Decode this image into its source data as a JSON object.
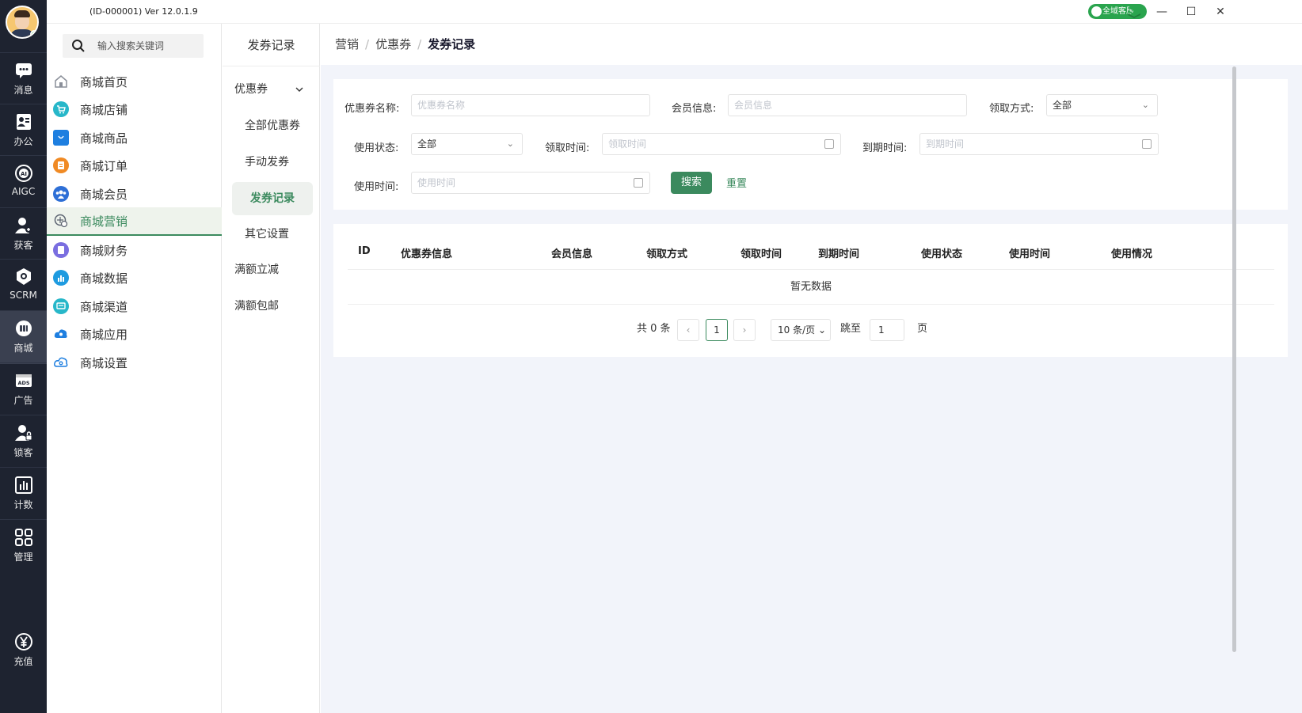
{
  "topbar": {
    "version": "(ID-000001)  Ver 12.0.1.9",
    "service_label": "全域客服",
    "minimize": "—",
    "maximize": "☐",
    "close": "✕"
  },
  "rail": [
    {
      "label": "消息",
      "icon": "chat-icon"
    },
    {
      "label": "办公",
      "icon": "id-card-icon"
    },
    {
      "label": "AIGC",
      "icon": "ai-icon"
    },
    {
      "label": "获客",
      "icon": "user-add-icon"
    },
    {
      "label": "SCRM",
      "icon": "scrm-icon"
    },
    {
      "label": "商城",
      "icon": "store-icon"
    },
    {
      "label": "广告",
      "icon": "ads-icon"
    },
    {
      "label": "锁客",
      "icon": "user-lock-icon"
    },
    {
      "label": "计数",
      "icon": "bar-chart-icon"
    },
    {
      "label": "管理",
      "icon": "grid-icon"
    },
    {
      "label": "充值",
      "icon": "yen-icon"
    }
  ],
  "search": {
    "placeholder": "输入搜索关键词"
  },
  "menu": [
    {
      "label": "商城首页",
      "color": "#8a8f99"
    },
    {
      "label": "商城店铺",
      "color": "#27b7c9"
    },
    {
      "label": "商城商品",
      "color": "#1e7fe0"
    },
    {
      "label": "商城订单",
      "color": "#f08a24"
    },
    {
      "label": "商城会员",
      "color": "#2e6fd6"
    },
    {
      "label": "商城营销",
      "color": "#3b8a5e"
    },
    {
      "label": "商城财务",
      "color": "#7a6ee0"
    },
    {
      "label": "商城数据",
      "color": "#1e9be0"
    },
    {
      "label": "商城渠道",
      "color": "#27b7c9"
    },
    {
      "label": "商城应用",
      "color": "#1e7fe0"
    },
    {
      "label": "商城设置",
      "color": "#1e7fe0"
    }
  ],
  "subnav": {
    "title": "发券记录",
    "group": "优惠券",
    "items": [
      "全部优惠券",
      "手动发券",
      "发券记录",
      "其它设置"
    ],
    "extra": [
      "满额立减",
      "满额包邮"
    ]
  },
  "breadcrumb": [
    "营销",
    "优惠券",
    "发券记录"
  ],
  "filters": {
    "coupon_name_label": "优惠券名称:",
    "coupon_name_placeholder": "优惠券名称",
    "member_label": "会员信息:",
    "member_placeholder": "会员信息",
    "receive_method_label": "领取方式:",
    "receive_method_value": "全部",
    "use_status_label": "使用状态:",
    "use_status_value": "全部",
    "receive_time_label": "领取时间:",
    "receive_time_placeholder": "领取时间",
    "expire_time_label": "到期时间:",
    "expire_time_placeholder": "到期时间",
    "use_time_label": "使用时间:",
    "use_time_placeholder": "使用时间",
    "search_button": "搜索",
    "reset_button": "重置"
  },
  "table": {
    "columns": [
      "ID",
      "优惠券信息",
      "会员信息",
      "领取方式",
      "领取时间",
      "到期时间",
      "使用状态",
      "使用时间",
      "使用情况"
    ],
    "empty_text": "暂无数据"
  },
  "pagination": {
    "total": "共 0 条",
    "prev": "‹",
    "current": "1",
    "next": "›",
    "page_size": "10 条/页",
    "jump_label": "跳至",
    "jump_value": "1",
    "page_suffix": "页"
  },
  "colors": {
    "accent": "#3b8a5e",
    "rail": "#1e2330"
  }
}
